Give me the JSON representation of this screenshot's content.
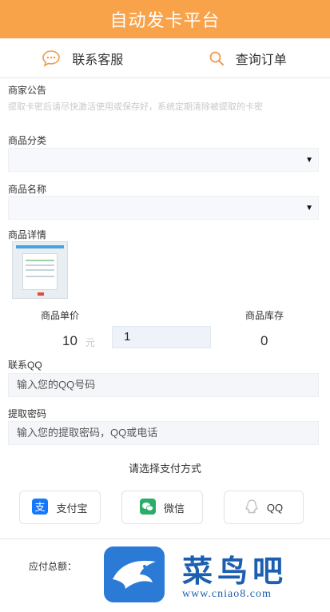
{
  "header": {
    "title": "自动发卡平台"
  },
  "nav": {
    "contact_label": "联系客服",
    "query_label": "查询订单"
  },
  "notice": {
    "label": "商家公告",
    "text": "提取卡密后请尽快激活使用或保存好，系统定期清除被提取的卡密"
  },
  "category": {
    "label": "商品分类",
    "value": ""
  },
  "product": {
    "label": "商品名称",
    "value": ""
  },
  "details": {
    "label": "商品详情"
  },
  "price": {
    "label": "商品单价",
    "value": "10",
    "unit": "元"
  },
  "quantity": {
    "value": "1"
  },
  "stock": {
    "label": "商品库存",
    "value": "0"
  },
  "contact_qq": {
    "label": "联系QQ",
    "placeholder": "输入您的QQ号码"
  },
  "extract_password": {
    "label": "提取密码",
    "placeholder": "输入您的提取密码，QQ或电话"
  },
  "payment": {
    "title": "请选择支付方式",
    "methods": [
      {
        "label": "支付宝",
        "icon": "alipay-icon",
        "color": "#1677ff"
      },
      {
        "label": "微信",
        "icon": "wechat-icon",
        "color": "#2aae67"
      },
      {
        "label": "QQ",
        "icon": "qq-icon",
        "color": "#bbbbbb"
      }
    ]
  },
  "total": {
    "label": "应付总额："
  },
  "watermark": {
    "name": "菜鸟吧",
    "url": "www.cniao8.com"
  },
  "colors": {
    "header_bg": "#f8a24a",
    "accent": "#f19a4b"
  }
}
